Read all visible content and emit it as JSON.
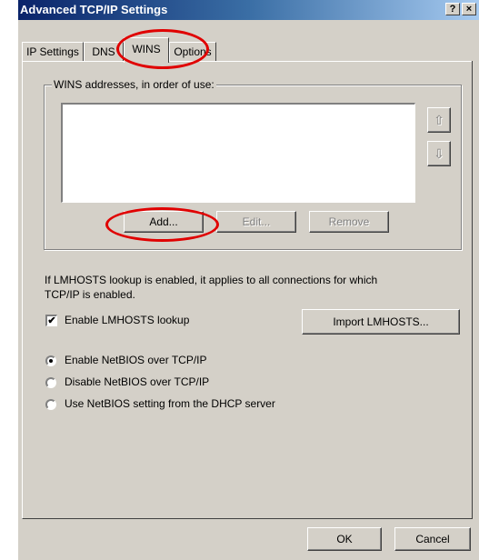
{
  "window": {
    "title": "Advanced TCP/IP Settings",
    "help_glyph": "?",
    "close_glyph": "×"
  },
  "tabs": [
    {
      "label": "IP Settings"
    },
    {
      "label": "DNS"
    },
    {
      "label": "WINS"
    },
    {
      "label": "Options"
    }
  ],
  "wins": {
    "group_label": "WINS addresses, in order of use:",
    "up_glyph": "⇧",
    "down_glyph": "⇩",
    "add_label": "Add...",
    "edit_label": "Edit...",
    "remove_label": "Remove"
  },
  "lmhosts": {
    "info_line1": "If LMHOSTS lookup is enabled, it applies to all connections for which",
    "info_line2": "TCP/IP is enabled.",
    "enable_label": "Enable LMHOSTS lookup",
    "enable_checked": true,
    "import_label": "Import LMHOSTS..."
  },
  "netbios": {
    "options": [
      {
        "label": "Enable NetBIOS over TCP/IP",
        "selected": true
      },
      {
        "label": "Disable NetBIOS over TCP/IP",
        "selected": false
      },
      {
        "label": "Use NetBIOS setting from the DHCP server",
        "selected": false
      }
    ]
  },
  "footer": {
    "ok_label": "OK",
    "cancel_label": "Cancel"
  },
  "colors": {
    "annotation": "#e00000",
    "face": "#d4d0c8"
  }
}
